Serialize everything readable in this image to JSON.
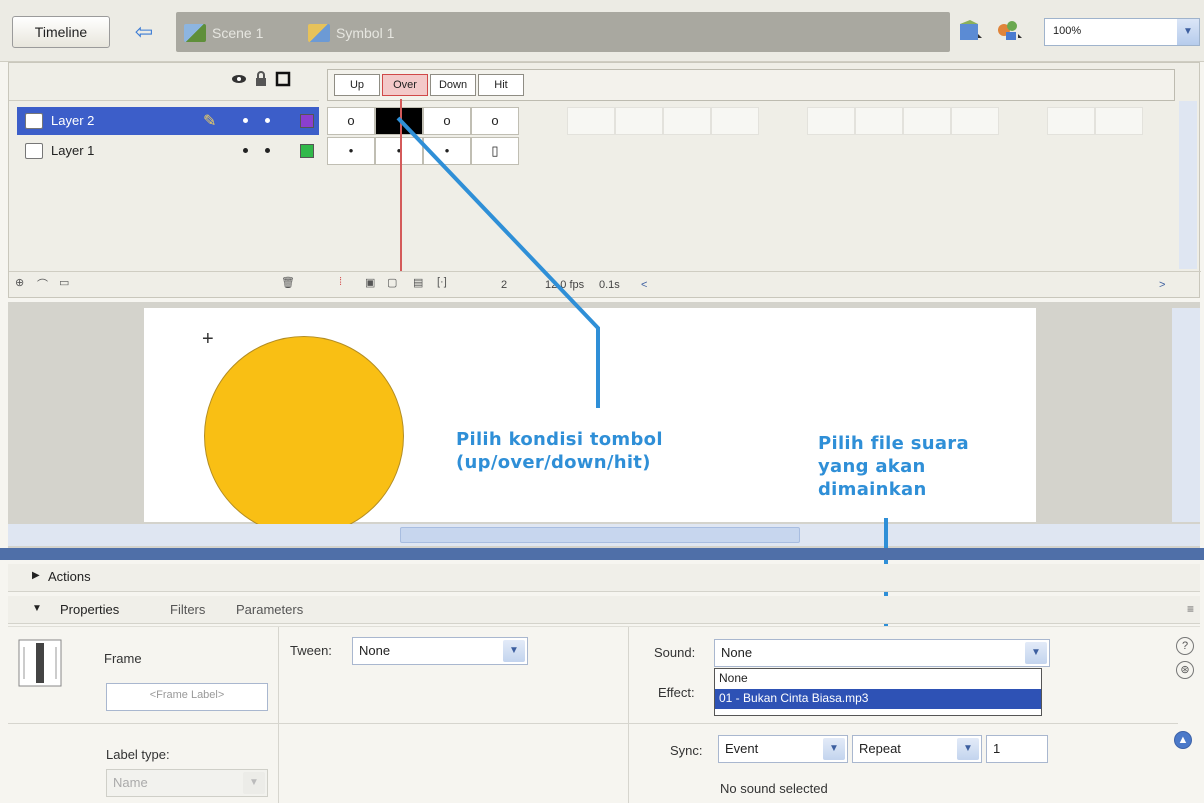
{
  "toolbar": {
    "timeline_label": "Timeline",
    "breadcrumb": [
      "Scene 1",
      "Symbol 1"
    ],
    "zoom_value": "100%",
    "icons": {
      "back": "back-arrow-icon",
      "edit_scene": "edit-scene-icon",
      "edit_symbol": "edit-symbol-icon"
    }
  },
  "timeline": {
    "frame_labels": [
      "Up",
      "Over",
      "Down",
      "Hit"
    ],
    "active_frame": "Over",
    "layers": [
      {
        "name": "Layer 2",
        "selected": true,
        "color": "#8b3fcf",
        "frames": [
          "o",
          "",
          "o",
          "o"
        ]
      },
      {
        "name": "Layer 1",
        "selected": false,
        "color": "#31b84a",
        "frames": [
          "•",
          "•",
          "•",
          "▯"
        ]
      }
    ],
    "current_frame": "2",
    "fps": "12.0 fps",
    "elapsed": "0.1s"
  },
  "stage": {
    "shape_color": "#f9bf14",
    "annotations": {
      "button_state": "Pilih kondisi tombol\n(up/over/down/hit)",
      "sound_file": "Pilih file suara\nyang akan\ndimainkan"
    },
    "annotation_color": "#2f8fd7"
  },
  "panels": {
    "actions_label": "Actions",
    "tabs": [
      "Properties",
      "Filters",
      "Parameters"
    ],
    "properties": {
      "frame_title": "Frame",
      "frame_label_placeholder": "<Frame Label>",
      "label_type_label": "Label type:",
      "label_type_value": "Name",
      "tween_label": "Tween:",
      "tween_value": "None",
      "sound_label": "Sound:",
      "sound_value": "None",
      "effect_label": "Effect:",
      "sound_options": [
        "None",
        "01 - Bukan Cinta Biasa.mp3"
      ],
      "sync_label": "Sync:",
      "sync_value": "Event",
      "repeat_value": "Repeat",
      "repeat_count": "1",
      "status": "No sound selected"
    }
  }
}
